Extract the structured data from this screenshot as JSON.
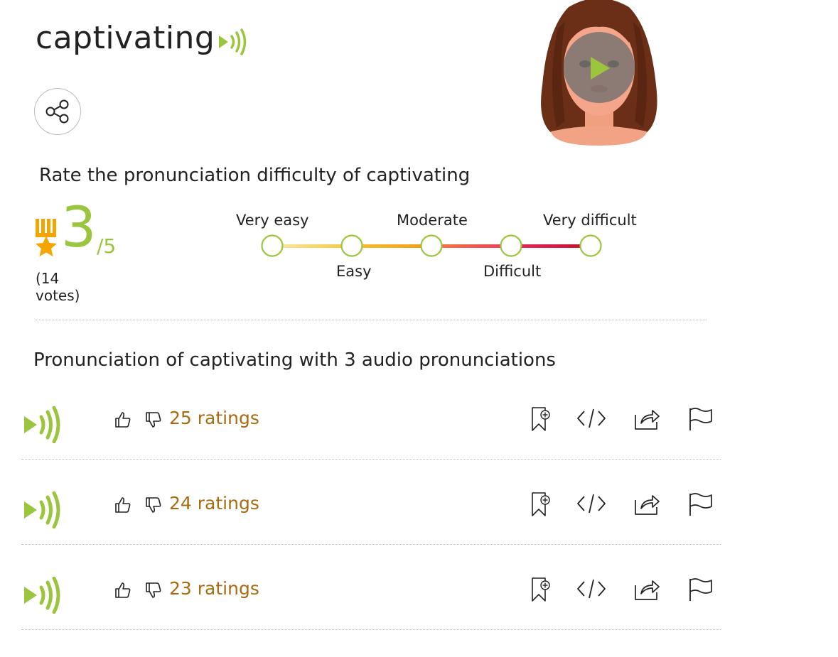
{
  "word": "captivating",
  "rating_section": {
    "heading": "Rate the pronunciation difficulty of captivating",
    "score": "3",
    "score_max": "/5",
    "votes": "(14 votes)",
    "scale_labels_top": [
      "Very easy",
      "Moderate",
      "Very difficult"
    ],
    "scale_labels_bottom": [
      "Easy",
      "Difficult"
    ]
  },
  "pronunciations": {
    "heading": "Pronunciation of captivating with 3 audio pronunciations",
    "items": [
      {
        "ratings": "25 ratings"
      },
      {
        "ratings": "24 ratings"
      },
      {
        "ratings": "23 ratings"
      }
    ]
  },
  "colors": {
    "accent_green": "#9bc53d",
    "rating_text": "#a86b12",
    "medal": "#f5a500"
  },
  "icons": [
    "audio-speaker-icon",
    "share-icon",
    "play-icon",
    "medal-icon",
    "thumbs-up-icon",
    "thumbs-down-icon",
    "bookmark-add-icon",
    "embed-code-icon",
    "share-arrow-icon",
    "flag-icon"
  ]
}
